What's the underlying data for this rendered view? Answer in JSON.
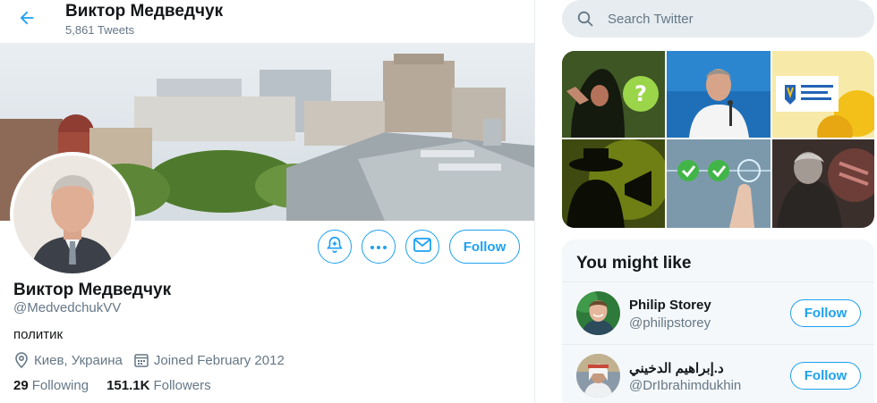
{
  "header": {
    "name": "Виктор Медведчук",
    "tweet_count": "5,861 Tweets"
  },
  "profile": {
    "name": "Виктор Медведчук",
    "handle": "@MedvedchukVV",
    "bio": "политик",
    "location": "Киев, Украина",
    "joined": "Joined February 2012",
    "following_count": "29",
    "following_label": "Following",
    "followers_count": "151.1K",
    "followers_label": "Followers",
    "follow_label": "Follow"
  },
  "icons": {
    "back": "arrow-left-icon",
    "notifications": "bell-plus-icon",
    "more": "more-dots-icon",
    "message": "envelope-icon",
    "location": "location-pin-icon",
    "calendar": "calendar-icon",
    "search": "search-icon"
  },
  "search": {
    "placeholder": "Search Twitter"
  },
  "sidebar": {
    "media_tiles": [
      "media-tile-hooded-figure",
      "media-tile-speaker-podium",
      "media-tile-independence-day",
      "media-tile-shadow-megaphone",
      "media-tile-checkmarks",
      "media-tile-elderly-man"
    ],
    "who_to_follow": {
      "title": "You might like",
      "users": [
        {
          "name": "Philip Storey",
          "handle": "@philipstorey",
          "follow_label": "Follow"
        },
        {
          "name": "د.إبراهيم الدخيني",
          "handle": "@DrIbrahimdukhin",
          "follow_label": "Follow"
        }
      ]
    }
  },
  "colors": {
    "accent": "#1da1f2",
    "secondary_text": "#657786",
    "border": "#e6ecf0",
    "panel_bg": "#f5f8fa"
  }
}
